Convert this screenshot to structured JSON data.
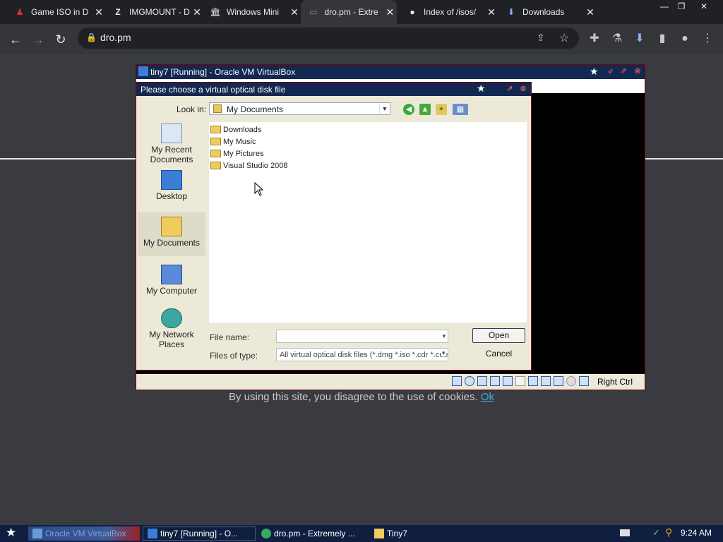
{
  "browser": {
    "tabs": [
      {
        "title": "Game ISO in D",
        "icon": "joystick-icon"
      },
      {
        "title": "IMGMOUNT - D",
        "icon": "z-icon"
      },
      {
        "title": "Windows Mini",
        "icon": "bank-icon"
      },
      {
        "title": "dro.pm - Extre",
        "icon": "folder-tab-icon",
        "active": true
      },
      {
        "title": "Index of /isos/",
        "icon": "github-icon"
      },
      {
        "title": "Downloads",
        "icon": "download-icon"
      }
    ],
    "tab_close": "✕",
    "window_controls": [
      "—",
      "❐",
      "✕"
    ],
    "url": "dro.pm"
  },
  "page": {
    "cookie_text": "By using this site, you disagree to the use of cookies.",
    "cookie_ok": "Ok"
  },
  "vbox": {
    "title": "tiny7 [Running] - Oracle VM VirtualBox",
    "host_key": "Right Ctrl"
  },
  "dialog": {
    "title": "Please choose a virtual optical disk file",
    "look_in_label": "Look in:",
    "look_in_value": "My Documents",
    "places": [
      {
        "label": "My Recent Documents"
      },
      {
        "label": "Desktop"
      },
      {
        "label": "My Documents",
        "selected": true
      },
      {
        "label": "My Computer"
      },
      {
        "label": "My Network Places"
      }
    ],
    "files": [
      {
        "name": "Downloads"
      },
      {
        "name": "My Music"
      },
      {
        "name": "My Pictures"
      },
      {
        "name": "Visual Studio 2008"
      }
    ],
    "file_name_label": "File name:",
    "file_name_value": "",
    "file_type_label": "Files of type:",
    "file_type_value": "All virtual optical disk files (*.dmg *.iso *.cdr *.cue",
    "open_label": "Open",
    "cancel_label": "Cancel"
  },
  "taskbar": {
    "tasks": [
      {
        "label": "Oracle VM VirtualBox"
      },
      {
        "label": "tiny7 [Running] - O..."
      },
      {
        "label": "dro.pm - Extremely ..."
      },
      {
        "label": "Tiny7"
      }
    ],
    "clock": "9:24 AM"
  },
  "colors": {
    "title_bar": "#122850",
    "window_border": "#800000",
    "browser_bg": "#202124",
    "page_bg": "#3a3b40",
    "link": "#4aa8d8"
  }
}
